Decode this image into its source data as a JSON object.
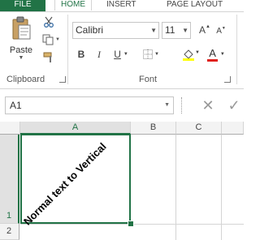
{
  "ribbon_tabs": {
    "file": "FILE",
    "home": "HOME",
    "insert": "INSERT",
    "page_layout": "PAGE LAYOUT"
  },
  "clipboard": {
    "paste_label": "Paste",
    "group_label": "Clipboard"
  },
  "font": {
    "font_name": "Calibri",
    "font_size": "11",
    "group_label": "Font",
    "bold": "B",
    "italic": "I",
    "underline": "U",
    "grow": "A",
    "shrink": "A",
    "font_color_glyph": "A"
  },
  "formula_bar": {
    "name_box": "A1",
    "cancel_glyph": "✕",
    "enter_glyph": "✓"
  },
  "sheet": {
    "columns": [
      "A",
      "B",
      "C"
    ],
    "rows": [
      "1",
      "2"
    ],
    "cell_a1": "Normal text to Vertical"
  },
  "colors": {
    "accent": "#217346",
    "fill_yellow": "#ffff00",
    "font_red": "#e0201c"
  }
}
